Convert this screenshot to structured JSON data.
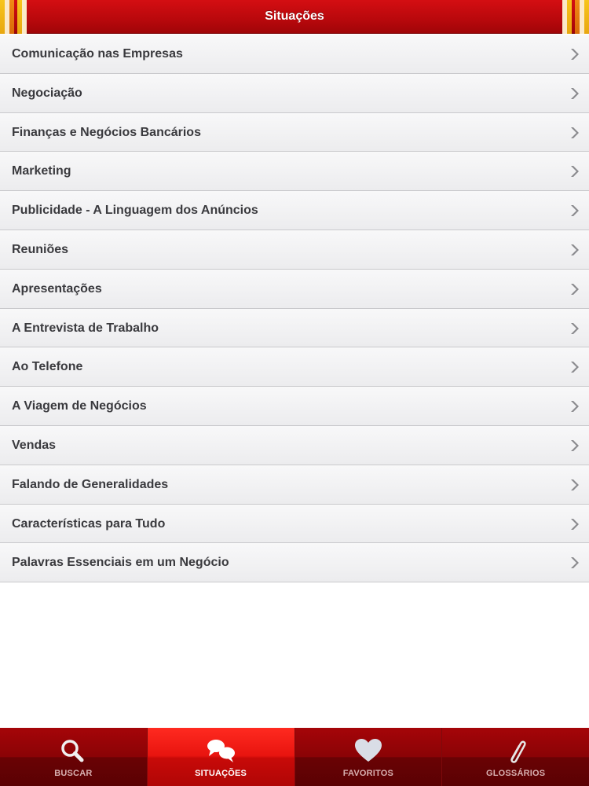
{
  "header": {
    "title": "Situações",
    "colors": {
      "bar": "#c00a0e",
      "stripe_yellow": "#f7c51c",
      "stripe_orange": "#f08a14"
    }
  },
  "list": {
    "items": [
      {
        "label": "Comunicação nas Empresas"
      },
      {
        "label": "Negociação"
      },
      {
        "label": "Finanças e Negócios Bancários"
      },
      {
        "label": "Marketing"
      },
      {
        "label": "Publicidade - A Linguagem dos Anúncios"
      },
      {
        "label": "Reuniões"
      },
      {
        "label": "Apresentações"
      },
      {
        "label": "A Entrevista de Trabalho"
      },
      {
        "label": "Ao Telefone"
      },
      {
        "label": "A Viagem de Negócios"
      },
      {
        "label": "Vendas"
      },
      {
        "label": "Falando de Generalidades"
      },
      {
        "label": "Características para Tudo"
      },
      {
        "label": "Palavras Essenciais em um Negócio"
      }
    ],
    "chevron_icon": "chevron-right-icon"
  },
  "tabbar": {
    "active_tab": "SITUAÇÕES",
    "tabs": [
      {
        "label": "BUSCAR",
        "icon": "search-icon"
      },
      {
        "label": "SITUAÇÕES",
        "icon": "speech-bubbles-icon"
      },
      {
        "label": "FAVORITOS",
        "icon": "heart-icon"
      },
      {
        "label": "GLOSSÁRIOS",
        "icon": "paperclip-icon"
      }
    ]
  }
}
